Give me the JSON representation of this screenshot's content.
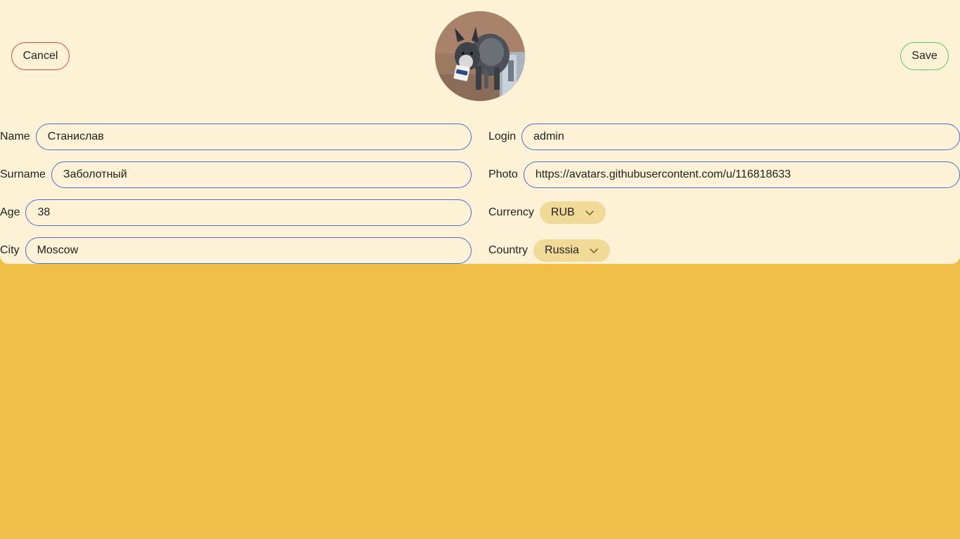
{
  "header": {
    "cancel_label": "Cancel",
    "save_label": "Save"
  },
  "profile": {
    "name_label": "Name",
    "name_value": "Станислав",
    "surname_label": "Surname",
    "surname_value": "Заболотный",
    "age_label": "Age",
    "age_value": "38",
    "city_label": "City",
    "city_value": "Moscow",
    "login_label": "Login",
    "login_value": "admin",
    "photo_label": "Photo",
    "photo_value": "https://avatars.githubusercontent.com/u/116818633",
    "currency_label": "Currency",
    "currency_value": "RUB",
    "country_label": "Country",
    "country_value": "Russia"
  },
  "colors": {
    "page_background": "#efbf47",
    "card_background": "#fdf2d6",
    "input_border": "#4a6cd8",
    "cancel_border": "#e24b4b",
    "save_border": "#4ecf62",
    "select_background": "#f1da98"
  },
  "icons": {
    "dropdown": "chevron-down-icon",
    "avatar": "dog-photo-avatar"
  }
}
